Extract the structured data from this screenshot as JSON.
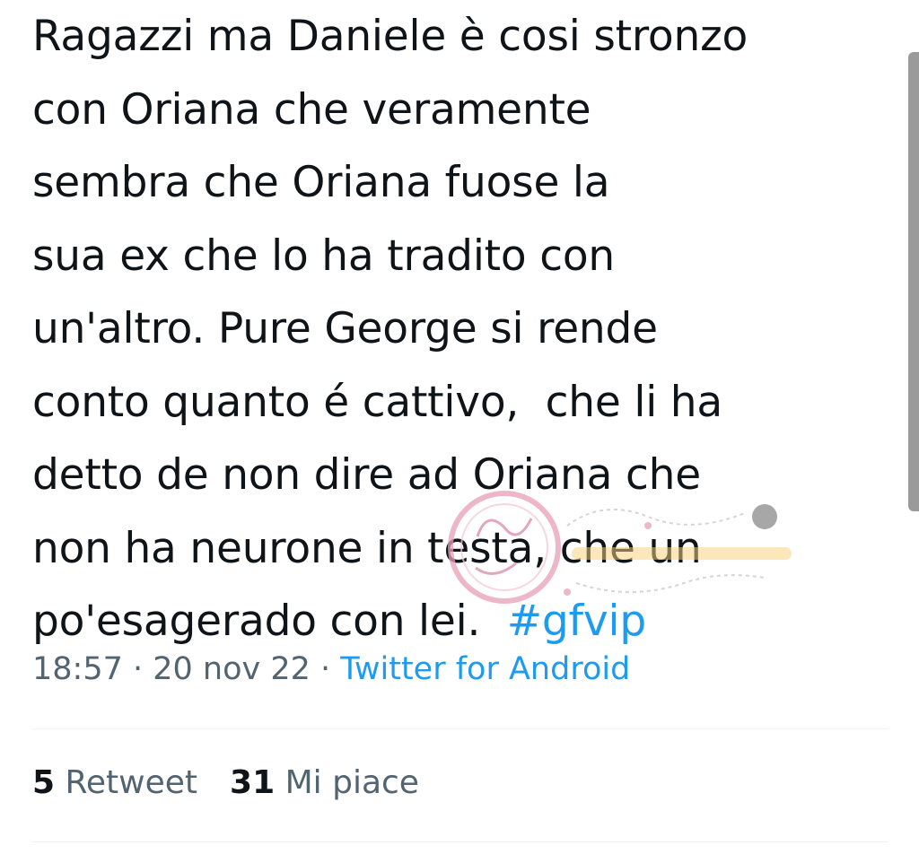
{
  "tweet": {
    "text_lines": [
      "Ragazzi ma Daniele è cosi stronzo",
      "con Oriana che veramente",
      "sembra che Oriana fuose la",
      "sua ex che lo ha tradito con",
      "un'altro. Pure George si rende",
      "conto quanto é cattivo,  che li ha",
      "detto de non dire ad Oriana che",
      "non ha neurone in testa, che un",
      "po'esagerado con lei.  "
    ],
    "hashtag": "#gfvip",
    "time": "18:57",
    "separator": " · ",
    "date": "20 nov 22",
    "source": "Twitter for Android"
  },
  "stats": {
    "retweets_count": "5",
    "retweets_label": " Retweet",
    "likes_count": "31",
    "likes_label": " Mi piace"
  },
  "colors": {
    "text": "#0f1419",
    "secondary": "#536471",
    "link": "#1d9bf0",
    "divider": "#eff3f4",
    "watermark": "#e8a0b8"
  }
}
